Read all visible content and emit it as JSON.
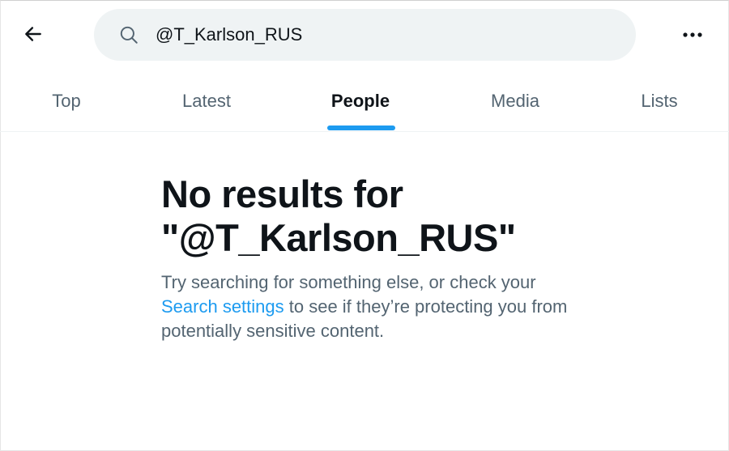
{
  "header": {
    "back_icon": "arrow-left-icon",
    "search": {
      "icon": "search-icon",
      "value": "@T_Karlson_RUS"
    },
    "more_icon": "more-horizontal-icon"
  },
  "tabs": [
    {
      "label": "Top",
      "active": false
    },
    {
      "label": "Latest",
      "active": false
    },
    {
      "label": "People",
      "active": true
    },
    {
      "label": "Media",
      "active": false
    },
    {
      "label": "Lists",
      "active": false
    }
  ],
  "empty_state": {
    "title_line1": "No results for",
    "title_line2": "\"@T_Karlson_RUS\"",
    "body_before": "Try searching for something else, or check your ",
    "link_text": "Search settings",
    "body_after": " to see if they’re protecting you from potentially sensitive content."
  },
  "colors": {
    "accent": "#1d9bf0",
    "text_primary": "#0f1419",
    "text_secondary": "#536471",
    "search_bg": "#eff3f4"
  }
}
